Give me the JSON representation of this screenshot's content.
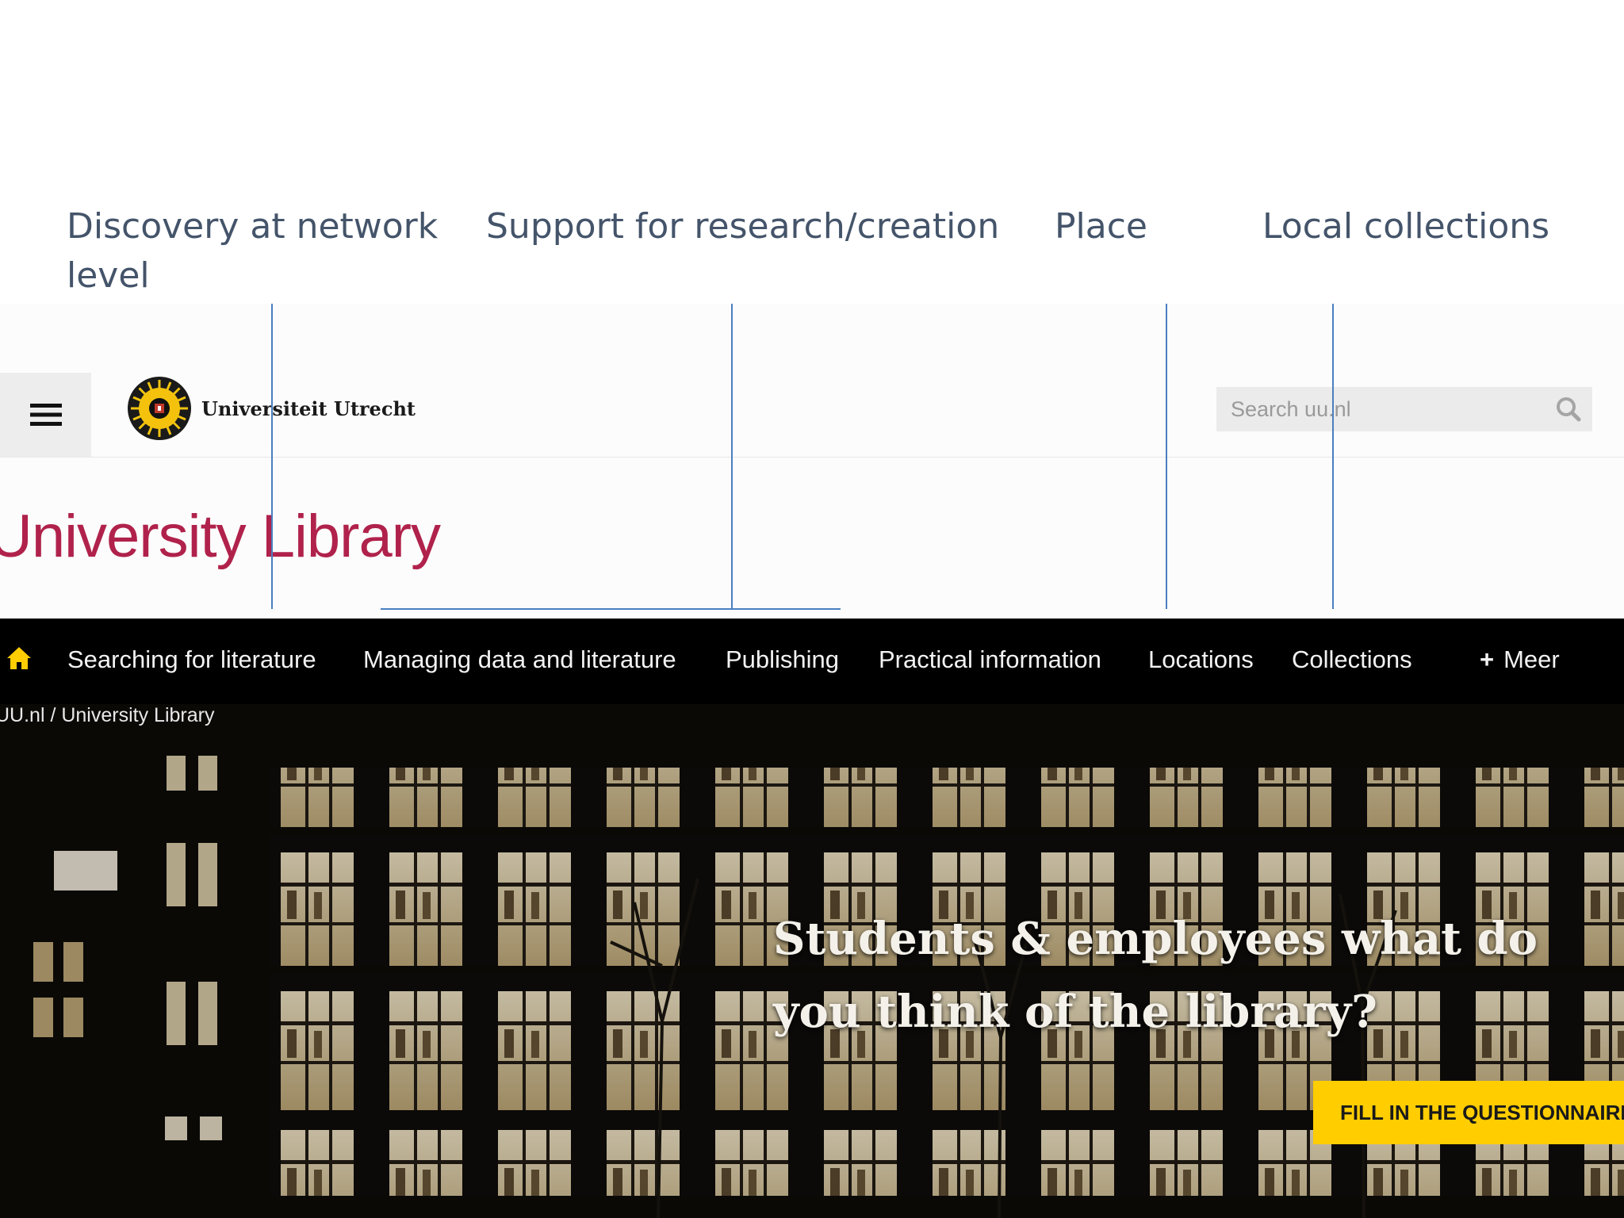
{
  "annotations": {
    "discovery": "Discovery at network level",
    "support": "Support for research/creation",
    "place": "Place",
    "local": "Local collections"
  },
  "header": {
    "menu_icon": "hamburger-menu-icon",
    "logo_text": "Universiteit Utrecht",
    "search_placeholder": "Search uu.nl",
    "search_icon": "search-icon",
    "site_title": "University Library"
  },
  "nav": {
    "home_icon": "home-icon",
    "items": [
      {
        "label": "Searching for literature"
      },
      {
        "label": "Managing data and literature"
      },
      {
        "label": "Publishing"
      },
      {
        "label": "Practical information"
      },
      {
        "label": "Locations"
      },
      {
        "label": "Collections"
      }
    ],
    "more_label": "Meer"
  },
  "hero": {
    "breadcrumb": "UU.nl / University Library",
    "title": "Students & employees what do you think of the library?",
    "cta_label": "FILL IN THE QUESTIONNAIRE"
  },
  "colors": {
    "title_red": "#b0224b",
    "nav_bg": "#000000",
    "cta_yellow": "#ffcd00",
    "home_icon_yellow": "#ffcd00",
    "annotation_text": "#44546a",
    "annotation_line": "#4a7fc0"
  }
}
